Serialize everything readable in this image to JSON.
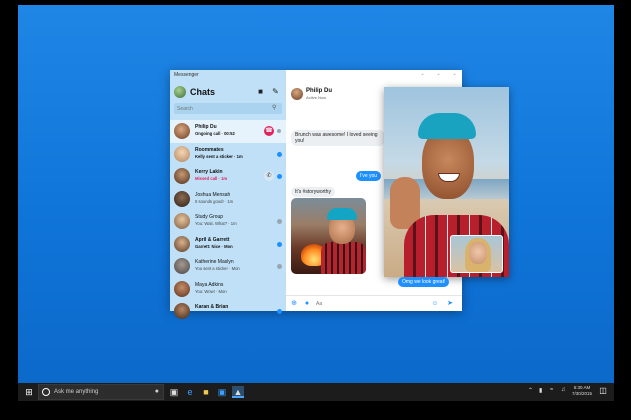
{
  "window": {
    "title": "Messenger",
    "controls": [
      "minimize",
      "maximize",
      "close"
    ]
  },
  "sidebar": {
    "heading": "Chats",
    "search_placeholder": "Search",
    "chats": [
      {
        "name": "Philip Du",
        "preview": "Ongoing call · 00:52",
        "active": true,
        "action": "end-call"
      },
      {
        "name": "Roommates",
        "preview": "Kelly sent a sticker · 1m",
        "bold": true,
        "dot": "blue"
      },
      {
        "name": "Kerry Lakin",
        "preview": "Missed call · 1m",
        "missed": true,
        "action": "phone",
        "dot": "blue"
      },
      {
        "name": "Joshua Mensah",
        "preview": "It sounds good! · 1m"
      },
      {
        "name": "Study Group",
        "preview": "You: Wait. What? · 1m",
        "dot": "grey"
      },
      {
        "name": "April & Garrett",
        "preview": "Garrett: Nice · Mon",
        "bold": true,
        "dot": "blue"
      },
      {
        "name": "Katherine Maslyn",
        "preview": "You sent a sticker · Mon",
        "dot": "grey"
      },
      {
        "name": "Maya Adkins",
        "preview": "You: Wow! · Mon"
      },
      {
        "name": "Karan & Brian",
        "preview": "",
        "dot": "blue"
      }
    ]
  },
  "conversation": {
    "contact_name": "Philip Du",
    "contact_status": "Active Now",
    "messages": [
      {
        "id": "msg1",
        "direction": "in",
        "text": "Brunch was awesome! I loved seeing you!"
      },
      {
        "id": "msg2",
        "direction": "out",
        "text": "I've you"
      },
      {
        "id": "msg3",
        "direction": "in",
        "text": "It's #storyworthy"
      },
      {
        "id": "msg4",
        "direction": "out",
        "text": "Omg we look great!"
      }
    ],
    "composer_placeholder": "Aa"
  },
  "taskbar": {
    "search_text": "Ask me anything",
    "time": "6:30 AM",
    "date": "7/30/2015"
  },
  "colors": {
    "accent": "#1e90ff",
    "sidebar": "#bfe0f6",
    "desktop": "#1379dc",
    "end_call": "#e0245e"
  }
}
